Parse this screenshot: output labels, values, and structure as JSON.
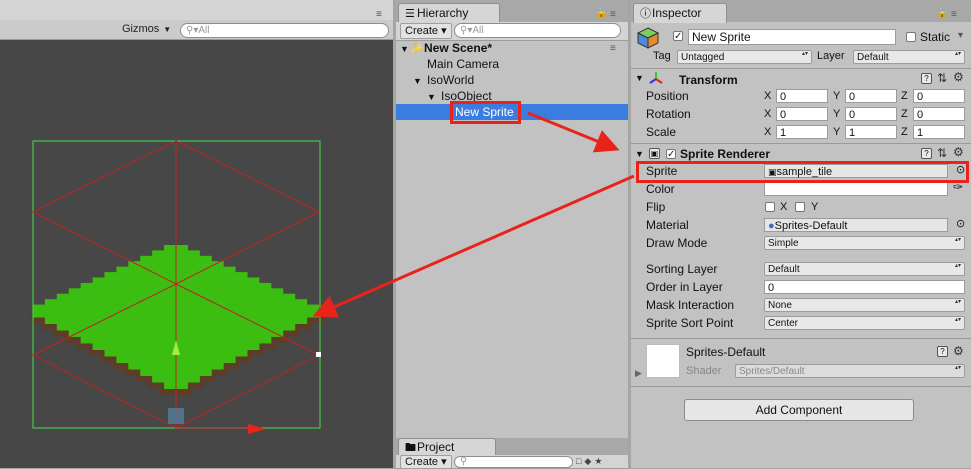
{
  "scene": {
    "gizmos_label": "Gizmos",
    "search_placeholder": "All",
    "colors": {
      "tile_green": "#3cbd12",
      "tile_brown": "#5c3d27",
      "bounds_green": "#46e046",
      "grid_red": "#c42020",
      "bg": "#474747"
    }
  },
  "hierarchy": {
    "tab_title": "Hierarchy",
    "create_label": "Create",
    "search_placeholder": "All",
    "scene_name": "New Scene*",
    "items": [
      {
        "label": "Main Camera"
      },
      {
        "label": "IsoWorld"
      },
      {
        "label": "IsoObject"
      },
      {
        "label": "New Sprite",
        "selected": true
      }
    ]
  },
  "project": {
    "tab_title": "Project",
    "create_label": "Create"
  },
  "inspector": {
    "tab_title": "Inspector",
    "object_name": "New Sprite",
    "static_label": "Static",
    "tag_label": "Tag",
    "tag_value": "Untagged",
    "layer_label": "Layer",
    "layer_value": "Default",
    "transform": {
      "title": "Transform",
      "rows": [
        {
          "label": "Position",
          "x": "0",
          "y": "0",
          "z": "0"
        },
        {
          "label": "Rotation",
          "x": "0",
          "y": "0",
          "z": "0"
        },
        {
          "label": "Scale",
          "x": "1",
          "y": "1",
          "z": "1"
        }
      ],
      "x_label": "X",
      "y_label": "Y",
      "z_label": "Z"
    },
    "sprite_renderer": {
      "title": "Sprite Renderer",
      "sprite_label": "Sprite",
      "sprite_value": "sample_tile",
      "color_label": "Color",
      "flip_label": "Flip",
      "flip_x": "X",
      "flip_y": "Y",
      "material_label": "Material",
      "material_value": "Sprites-Default",
      "draw_mode_label": "Draw Mode",
      "draw_mode_value": "Simple",
      "sorting_layer_label": "Sorting Layer",
      "sorting_layer_value": "Default",
      "order_label": "Order in Layer",
      "order_value": "0",
      "mask_label": "Mask Interaction",
      "mask_value": "None",
      "sort_point_label": "Sprite Sort Point",
      "sort_point_value": "Center"
    },
    "material": {
      "name": "Sprites-Default",
      "shader_label": "Shader",
      "shader_value": "Sprites/Default"
    },
    "add_component_label": "Add Component"
  }
}
